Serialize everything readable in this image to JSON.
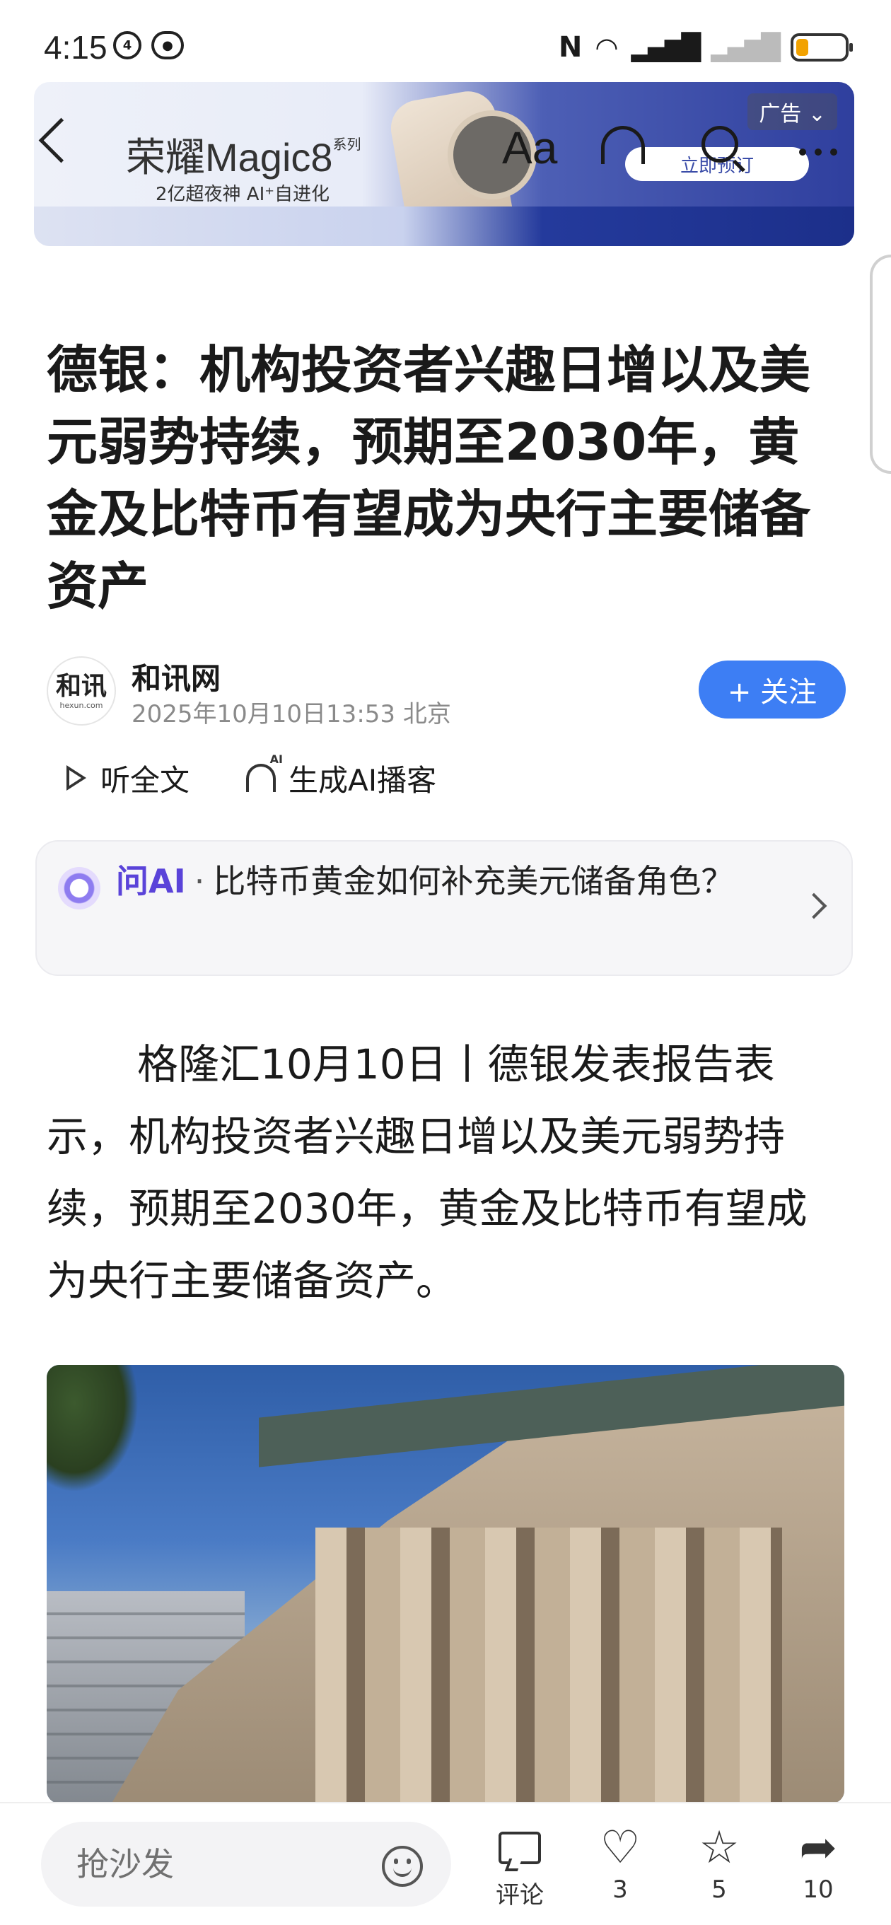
{
  "status_bar": {
    "time": "4:15",
    "icons": [
      "nfc-icon",
      "wifi-icon",
      "signal-icon",
      "signal-no-sim-icon",
      "battery-icon"
    ],
    "battery_level": 0.25,
    "battery_color": "#f2a200"
  },
  "ad": {
    "brand": "荣耀Magic8",
    "brand_suffix": "系列",
    "tagline": "2亿超夜神  AI⁺自进化",
    "cta": "立即预订",
    "label": "广告"
  },
  "nav": {
    "font_button": "Aa"
  },
  "article": {
    "title": "德银：机构投资者兴趣日增以及美元弱势持续，预期至2030年，黄金及比特币有望成为央行主要储备资产",
    "author": "和讯网",
    "author_logo": "和讯",
    "author_logo_sub": "hexun.com",
    "meta": "2025年10月10日13:53 北京",
    "follow_label": "+ 关注",
    "listen_label": "听全文",
    "podcast_label": "生成AI播客",
    "body": "格隆汇10月10日丨德银发表报告表示，机构投资者兴趣日增以及美元弱势持续，预期至2030年，黄金及比特币有望成为央行主要储备资产。"
  },
  "ask_ai": {
    "label": "问AI",
    "question": "比特币黄金如何补充美元储备角色？"
  },
  "bottom_bar": {
    "placeholder": "抢沙发",
    "comment_label": "评论",
    "like_count": "3",
    "favorite_count": "5",
    "share_count": "10"
  },
  "colors": {
    "accent": "#3d7ef4",
    "ai_purple": "#5a43d9"
  }
}
